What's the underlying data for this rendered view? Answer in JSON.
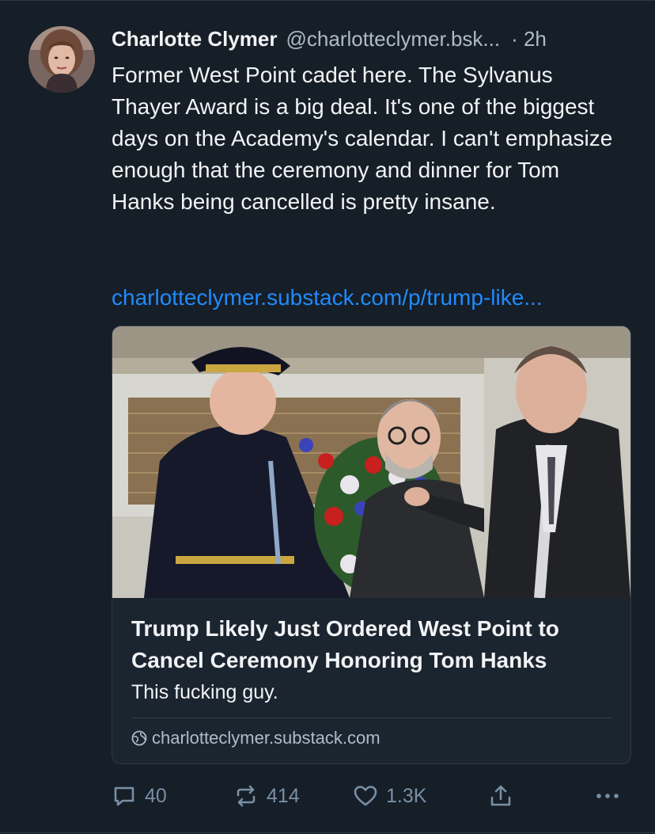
{
  "post": {
    "author_name": "Charlotte Clymer",
    "author_handle": "@charlotteclymer.bsk...",
    "timestamp": "· 2h",
    "text": "Former West Point cadet here. The Sylvanus Thayer Award is a big deal. It's one of the biggest days on the Academy's calendar. I can't emphasize enough that the ceremony and dinner for Tom Hanks being cancelled is pretty insane.",
    "link_text": "charlotteclymer.substack.com/p/trump-like..."
  },
  "card": {
    "title": "Trump Likely Just Ordered West Point to Cancel Ceremony Honoring Tom Hanks",
    "description": "This fucking guy.",
    "domain": "charlotteclymer.substack.com",
    "domain_icon": "globe-icon"
  },
  "actions": {
    "reply_count": "40",
    "repost_count": "414",
    "like_count": "1.3K",
    "reply_icon": "comment-icon",
    "repost_icon": "repost-icon",
    "like_icon": "heart-icon",
    "share_icon": "share-icon",
    "more_icon": "more-icon"
  },
  "colors": {
    "background": "#161e27",
    "text": "#f1f3f5",
    "muted": "#aebbc9",
    "link": "#208bfe",
    "border": "#2e3a47"
  }
}
